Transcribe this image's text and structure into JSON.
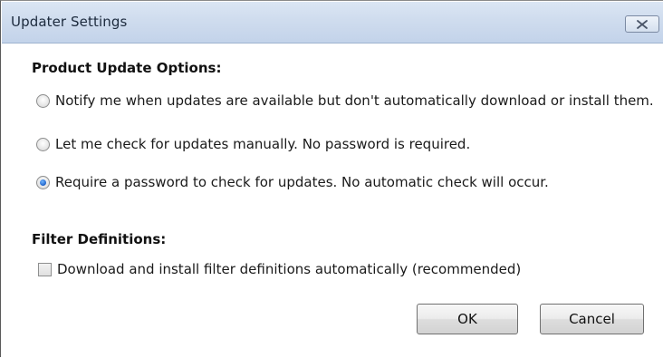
{
  "window": {
    "title": "Updater Settings"
  },
  "product_update": {
    "heading": "Product Update Options:",
    "options": [
      {
        "label": "Notify me when updates are available but don't automatically download or install them.",
        "checked": false
      },
      {
        "label": "Let me check for updates manually. No password is required.",
        "checked": false
      },
      {
        "label": "Require a password to check for updates.  No automatic check will occur.",
        "checked": true
      }
    ]
  },
  "filter_definitions": {
    "heading": "Filter Definitions:",
    "checkbox_label": "Download and install filter definitions automatically (recommended)",
    "checked": false
  },
  "buttons": {
    "ok_label": "OK",
    "cancel_label": "Cancel"
  },
  "colors": {
    "titlebar": "#cfdcee",
    "radio_selected": "#1f62c9"
  }
}
